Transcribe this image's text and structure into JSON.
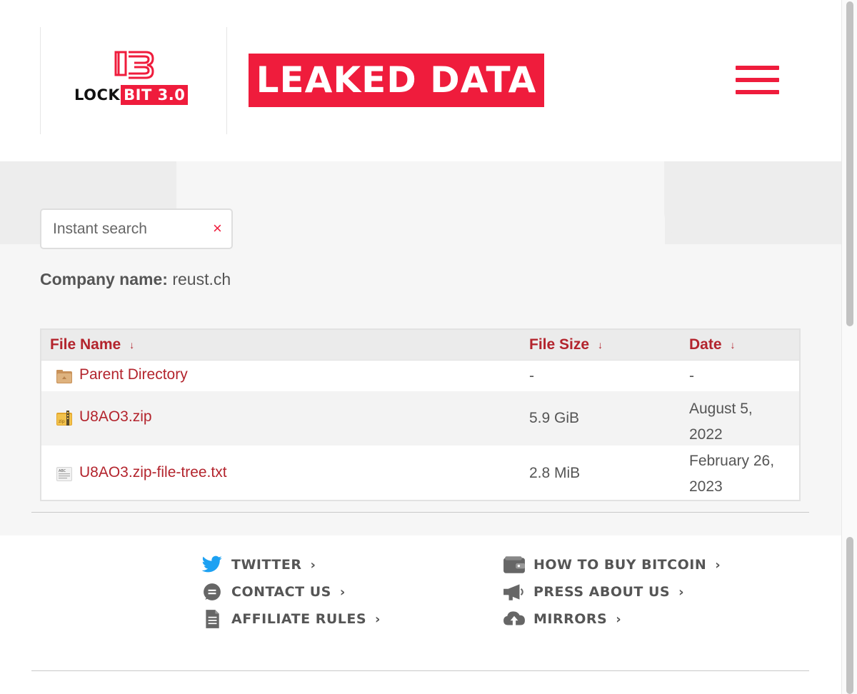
{
  "header": {
    "logo_prefix": "LOCK",
    "logo_highlight": "BIT 3.0",
    "banner": "LEAKED DATA",
    "brand_color": "#ef1c3c"
  },
  "search": {
    "placeholder": "Instant search",
    "clear_glyph": "×"
  },
  "company": {
    "label": "Company name:",
    "value": "reust.ch"
  },
  "table": {
    "columns": [
      {
        "label": "File Name",
        "sort_glyph": "↓"
      },
      {
        "label": "File Size",
        "sort_glyph": "↓"
      },
      {
        "label": "Date",
        "sort_glyph": "↓"
      }
    ],
    "rows": [
      {
        "icon": "folder-icon",
        "name": "Parent Directory",
        "size": "-",
        "date_line1": "-",
        "date_line2": ""
      },
      {
        "icon": "zip-file-icon",
        "name": "U8AO3.zip",
        "size": "5.9 GiB",
        "date_line1": "August 5,",
        "date_line2": "2022"
      },
      {
        "icon": "text-file-icon",
        "name": "U8AO3.zip-file-tree.txt",
        "size": "2.8 MiB",
        "date_line1": "February 26,",
        "date_line2": "2023"
      }
    ]
  },
  "footer": {
    "links": [
      {
        "icon": "twitter-icon",
        "label": "TWITTER"
      },
      {
        "icon": "chat-icon",
        "label": "CONTACT US"
      },
      {
        "icon": "document-icon",
        "label": "AFFILIATE RULES"
      },
      {
        "icon": "wallet-icon",
        "label": "HOW TO BUY BITCOIN"
      },
      {
        "icon": "megaphone-icon",
        "label": "PRESS ABOUT US"
      },
      {
        "icon": "cloud-upload-icon",
        "label": "MIRRORS"
      }
    ],
    "chevron": "›",
    "twitter_color": "#1da1f2"
  }
}
